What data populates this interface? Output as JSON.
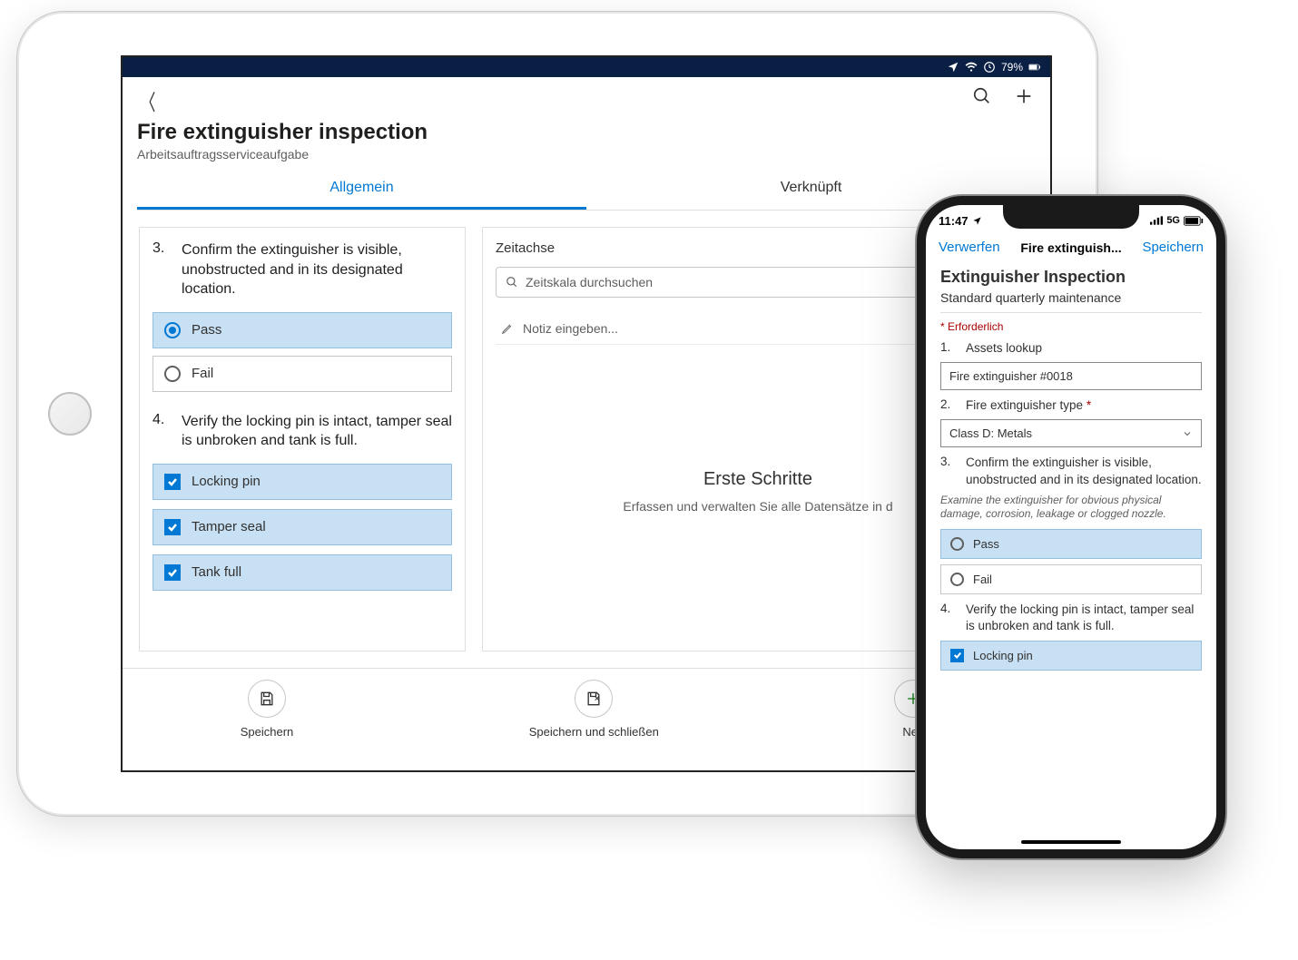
{
  "tablet": {
    "status": {
      "battery": "79%"
    },
    "title": "Fire extinguisher inspection",
    "subtype": "Arbeitsauftragsserviceaufgabe",
    "tabs": {
      "general": "Allgemein",
      "related": "Verknüpft"
    },
    "q3": {
      "num": "3.",
      "text": "Confirm the extinguisher is visible, unobstructed and in its designated location.",
      "pass": "Pass",
      "fail": "Fail"
    },
    "q4": {
      "num": "4.",
      "text": "Verify the locking pin is intact, tamper seal is unbroken and tank is full.",
      "c1": "Locking pin",
      "c2": "Tamper seal",
      "c3": "Tank full"
    },
    "timeline": {
      "title": "Zeitachse",
      "search_placeholder": "Zeitskala durchsuchen",
      "note_placeholder": "Notiz eingeben...",
      "empty_title": "Erste Schritte",
      "empty_text": "Erfassen und verwalten Sie alle Datensätze in d"
    },
    "cmd": {
      "save": "Speichern",
      "save_close": "Speichern und schließen",
      "new": "Neu"
    }
  },
  "phone": {
    "status_time": "11:47",
    "status_net": "5G",
    "nav": {
      "discard": "Verwerfen",
      "title": "Fire extinguish...",
      "save": "Speichern"
    },
    "h1": "Extinguisher Inspection",
    "sub": "Standard quarterly maintenance",
    "required": "Erforderlich",
    "q1": {
      "num": "1.",
      "text": "Assets lookup",
      "value": "Fire extinguisher #0018"
    },
    "q2": {
      "num": "2.",
      "text": "Fire extinguisher type",
      "value": "Class D: Metals"
    },
    "q3": {
      "num": "3.",
      "text": "Confirm the extinguisher is visible, unobstructed and in its designated location.",
      "help": "Examine the extinguisher for obvious physical damage, corrosion, leakage or clogged nozzle.",
      "pass": "Pass",
      "fail": "Fail"
    },
    "q4": {
      "num": "4.",
      "text": "Verify the locking pin is intact, tamper seal is unbroken and tank is full.",
      "c1": "Locking pin"
    }
  }
}
